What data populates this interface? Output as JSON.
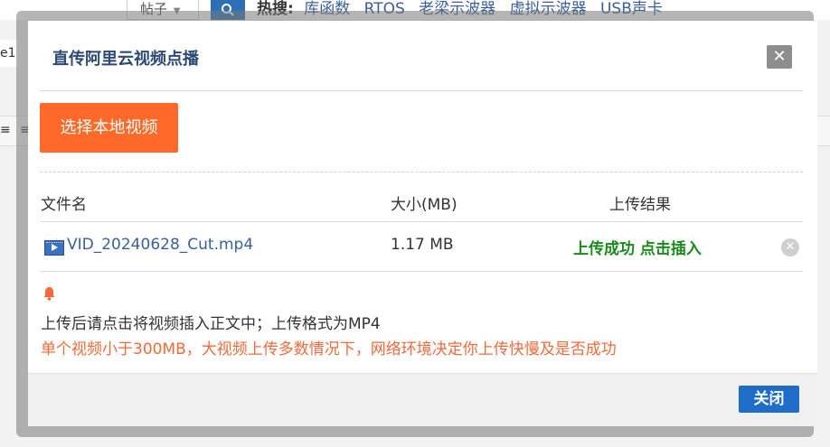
{
  "background": {
    "search_select_label": "帖子",
    "search_icon": "search-icon",
    "hot_label": "热搜:",
    "hot_links": [
      "库函数",
      "RTOS",
      "老梁示波器",
      "虚拟示波器",
      "USB声卡"
    ],
    "line_label": "e1"
  },
  "dialog": {
    "title": "直传阿里云视频点播",
    "close_symbol": "✕",
    "select_button": "选择本地视频",
    "table": {
      "headers": [
        "文件名",
        "大小(MB)",
        "上传结果"
      ],
      "rows": [
        {
          "name": "VID_20240628_Cut.mp4",
          "size": "1.17 MB",
          "result": "上传成功 点击插入",
          "remove_symbol": "✕"
        }
      ]
    },
    "notice_line1": "上传后请点击将视频插入正文中；上传格式为MP4",
    "notice_line2": "单个视频小于300MB，大视频上传多数情况下，网络环境决定你上传快慢及是否成功",
    "footer_button": "关闭"
  },
  "colors": {
    "accent_orange": "#ff6a2a",
    "success_green": "#1a8a1a",
    "primary_blue": "#1f6cc9",
    "warning_text": "#f06a3a"
  }
}
